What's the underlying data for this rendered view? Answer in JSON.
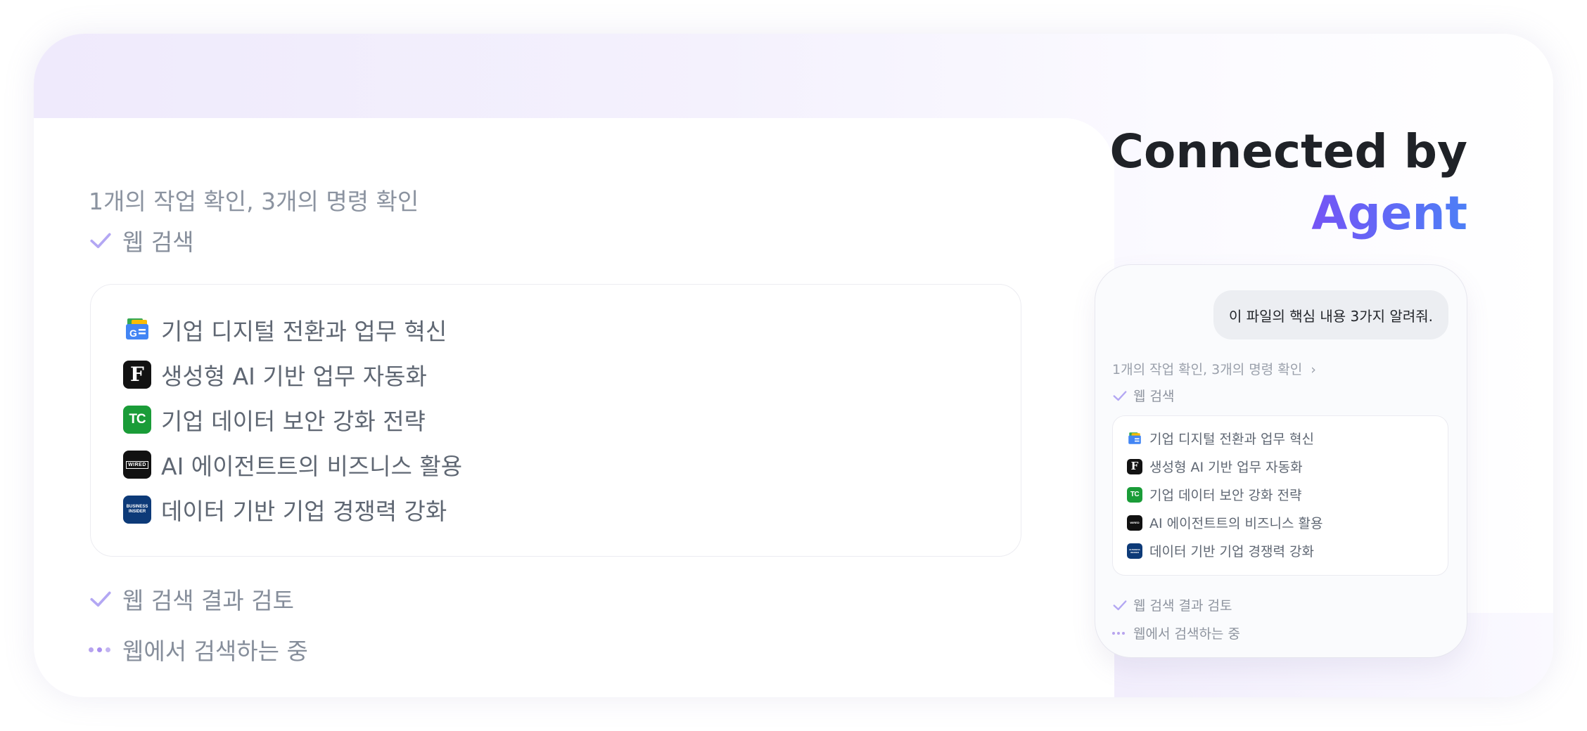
{
  "heading": {
    "line1": "Connected by",
    "line2": "Agent"
  },
  "progress": {
    "summary": "1개의 작업 확인, 3개의 명령 확인",
    "summary_chevron": "›",
    "steps": [
      {
        "label": "웹 검색",
        "status": "done"
      },
      {
        "label": "웹 검색 결과 검토",
        "status": "done"
      },
      {
        "label": "웹에서 검색하는 중",
        "status": "in-progress"
      }
    ]
  },
  "sources": [
    {
      "title": "기업 디지털 전환과 업무 혁신",
      "icon": "google-news-icon"
    },
    {
      "title": "생성형 AI 기반 업무 자동화",
      "icon": "f-logo-icon",
      "icon_text": "F"
    },
    {
      "title": "기업 데이터 보안 강화 전략",
      "icon": "techcrunch-icon",
      "icon_text": "TC"
    },
    {
      "title": "AI 에이전트트의 비즈니스 활용",
      "icon": "wired-icon",
      "icon_text": "WIRED"
    },
    {
      "title": "데이터 기반 기업 경쟁력 강화",
      "icon": "business-insider-icon",
      "icon_text": "BUSINESS INSIDER"
    }
  ],
  "chat": {
    "user_message": "이 파일의 핵심 내용 3가지 알려줘."
  },
  "colors": {
    "accent_purple": "#8a3ff3",
    "accent_blue": "#4d7ff6",
    "check": "#b3a7f3",
    "techcrunch_green": "#1a9c38",
    "insider_navy": "#0d3a78"
  }
}
